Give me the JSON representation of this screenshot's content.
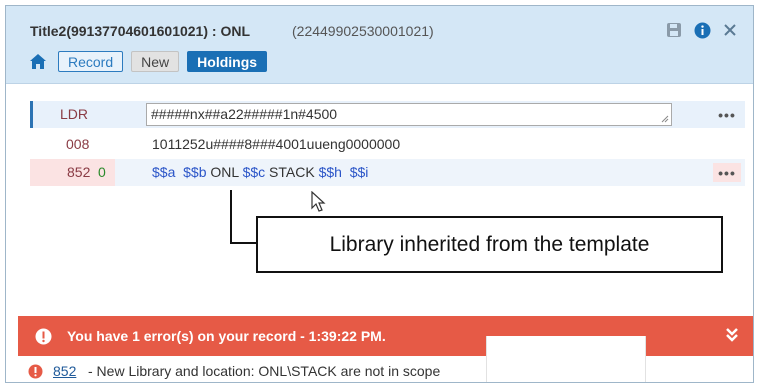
{
  "header": {
    "title": "Title2(99137704601601021) : ONL",
    "subtitle": "(22449902530001021)",
    "icons": [
      "save-icon",
      "info-icon",
      "close-icon"
    ]
  },
  "tabs": [
    {
      "label": "Record",
      "state": "outlined"
    },
    {
      "label": "New",
      "state": "default"
    },
    {
      "label": "Holdings",
      "state": "active"
    }
  ],
  "fields": {
    "ldr": {
      "tag": "LDR",
      "value": "#####nx##a22#####1n#4500",
      "more": "•••"
    },
    "f008": {
      "tag": "008",
      "value": "1011252u####8###4001uueng0000000"
    },
    "f852": {
      "tag": "852",
      "indicator": "0",
      "subfields": {
        "a": "$$a",
        "b": "$$b",
        "b_val": "ONL",
        "c": "$$c",
        "c_val": "STACK",
        "h": "$$h",
        "i": "$$i"
      },
      "more": "•••"
    }
  },
  "callout": {
    "text": "Library inherited from the template"
  },
  "error_bar": {
    "text": "You have 1 error(s) on your record - 1:39:22 PM.",
    "color": "#e65a46"
  },
  "message": {
    "link": "852",
    "text": "- New Library and location: ONL\\STACK are not in scope"
  },
  "colors": {
    "accent": "#1a6fb5",
    "header_bg": "#d4e7f6",
    "error": "#e65a46"
  }
}
